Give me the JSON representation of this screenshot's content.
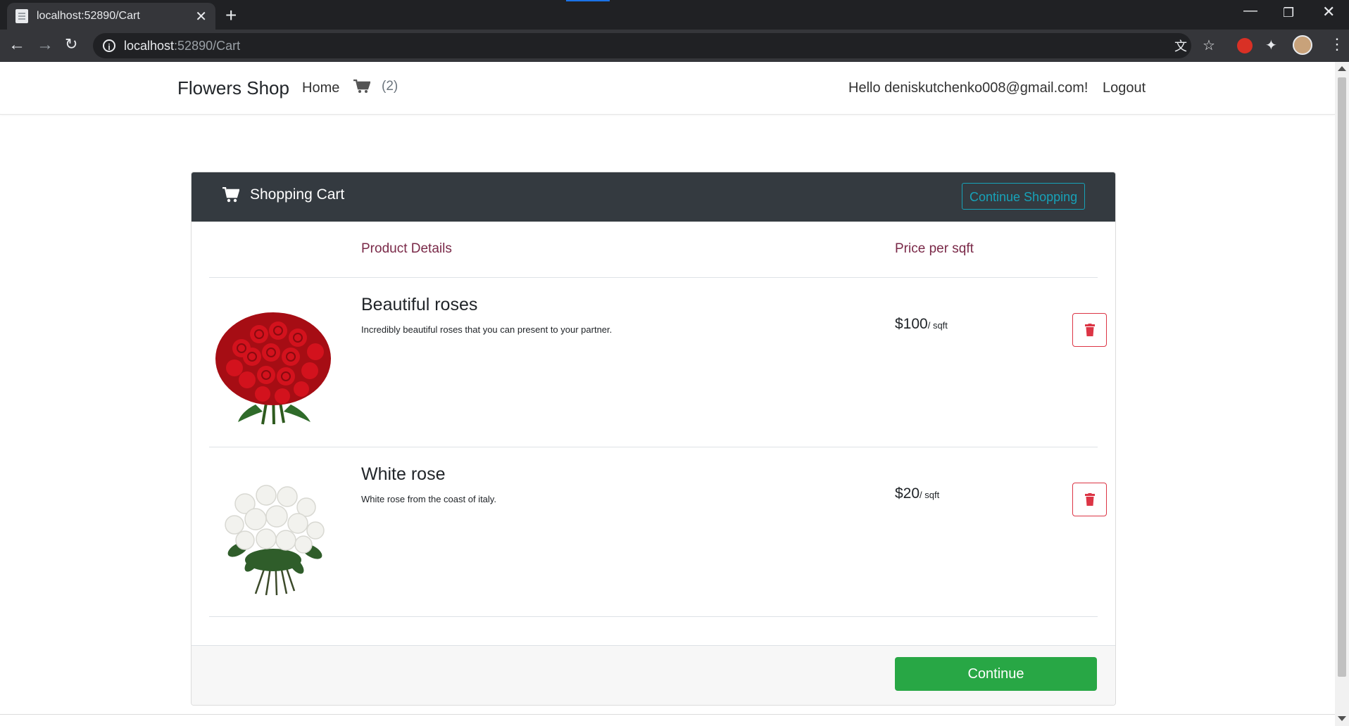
{
  "browser": {
    "tab_title": "localhost:52890/Cart",
    "url_host": "localhost",
    "url_rest": ":52890/Cart",
    "new_tab": "+",
    "close_tab": "✕"
  },
  "nav": {
    "brand": "Flowers Shop",
    "home": "Home",
    "cart_count": "(2)",
    "greeting": "Hello deniskutchenko008@gmail.com!",
    "logout": "Logout"
  },
  "cart": {
    "title": "Shopping Cart",
    "continue_shopping": "Continue Shopping",
    "columns": {
      "details": "Product Details",
      "price": "Price per sqft"
    },
    "items": [
      {
        "name": "Beautiful roses",
        "description": "Incredibly beautiful roses that you can present to your partner.",
        "price": "$100",
        "unit": "/ sqft",
        "image": "red-roses-bouquet"
      },
      {
        "name": "White rose",
        "description": "White rose from the coast of italy.",
        "price": "$20",
        "unit": "/ sqft",
        "image": "white-roses-bouquet"
      }
    ],
    "continue": "Continue"
  },
  "colors": {
    "header_bg": "#343a40",
    "accent_info": "#17a2b8",
    "column_header": "#7a2948",
    "delete_red": "#dc3545",
    "continue_green": "#28a745"
  }
}
